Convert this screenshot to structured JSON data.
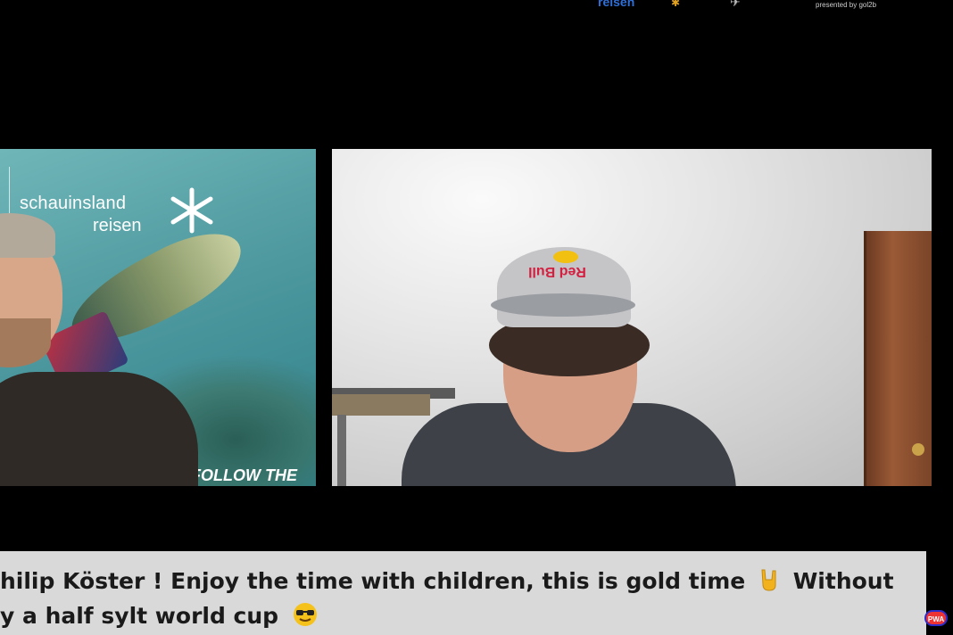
{
  "sponsors": {
    "reisen": "reisen",
    "presented_by": "presented by gol2b"
  },
  "left_tile": {
    "brand_line1": "schauinsland",
    "brand_line2": "reisen",
    "banner_text": "FOLLOW THE"
  },
  "right_tile": {
    "cap_logo": "Red Bull"
  },
  "chat": {
    "line1_text": "hilip Köster ! Enjoy the time with children, this is gold time",
    "line1_tail": "Without",
    "line2_text": "y a half sylt world cup"
  },
  "badge": {
    "label": "PWA"
  },
  "colors": {
    "background": "#000000",
    "chat_banner": "#d9d9d9",
    "brand_teal": "#4f9aa0"
  },
  "icons": [
    "sign-of-horns-emoji",
    "sunglasses-emoji",
    "snowflake-logo-icon"
  ]
}
